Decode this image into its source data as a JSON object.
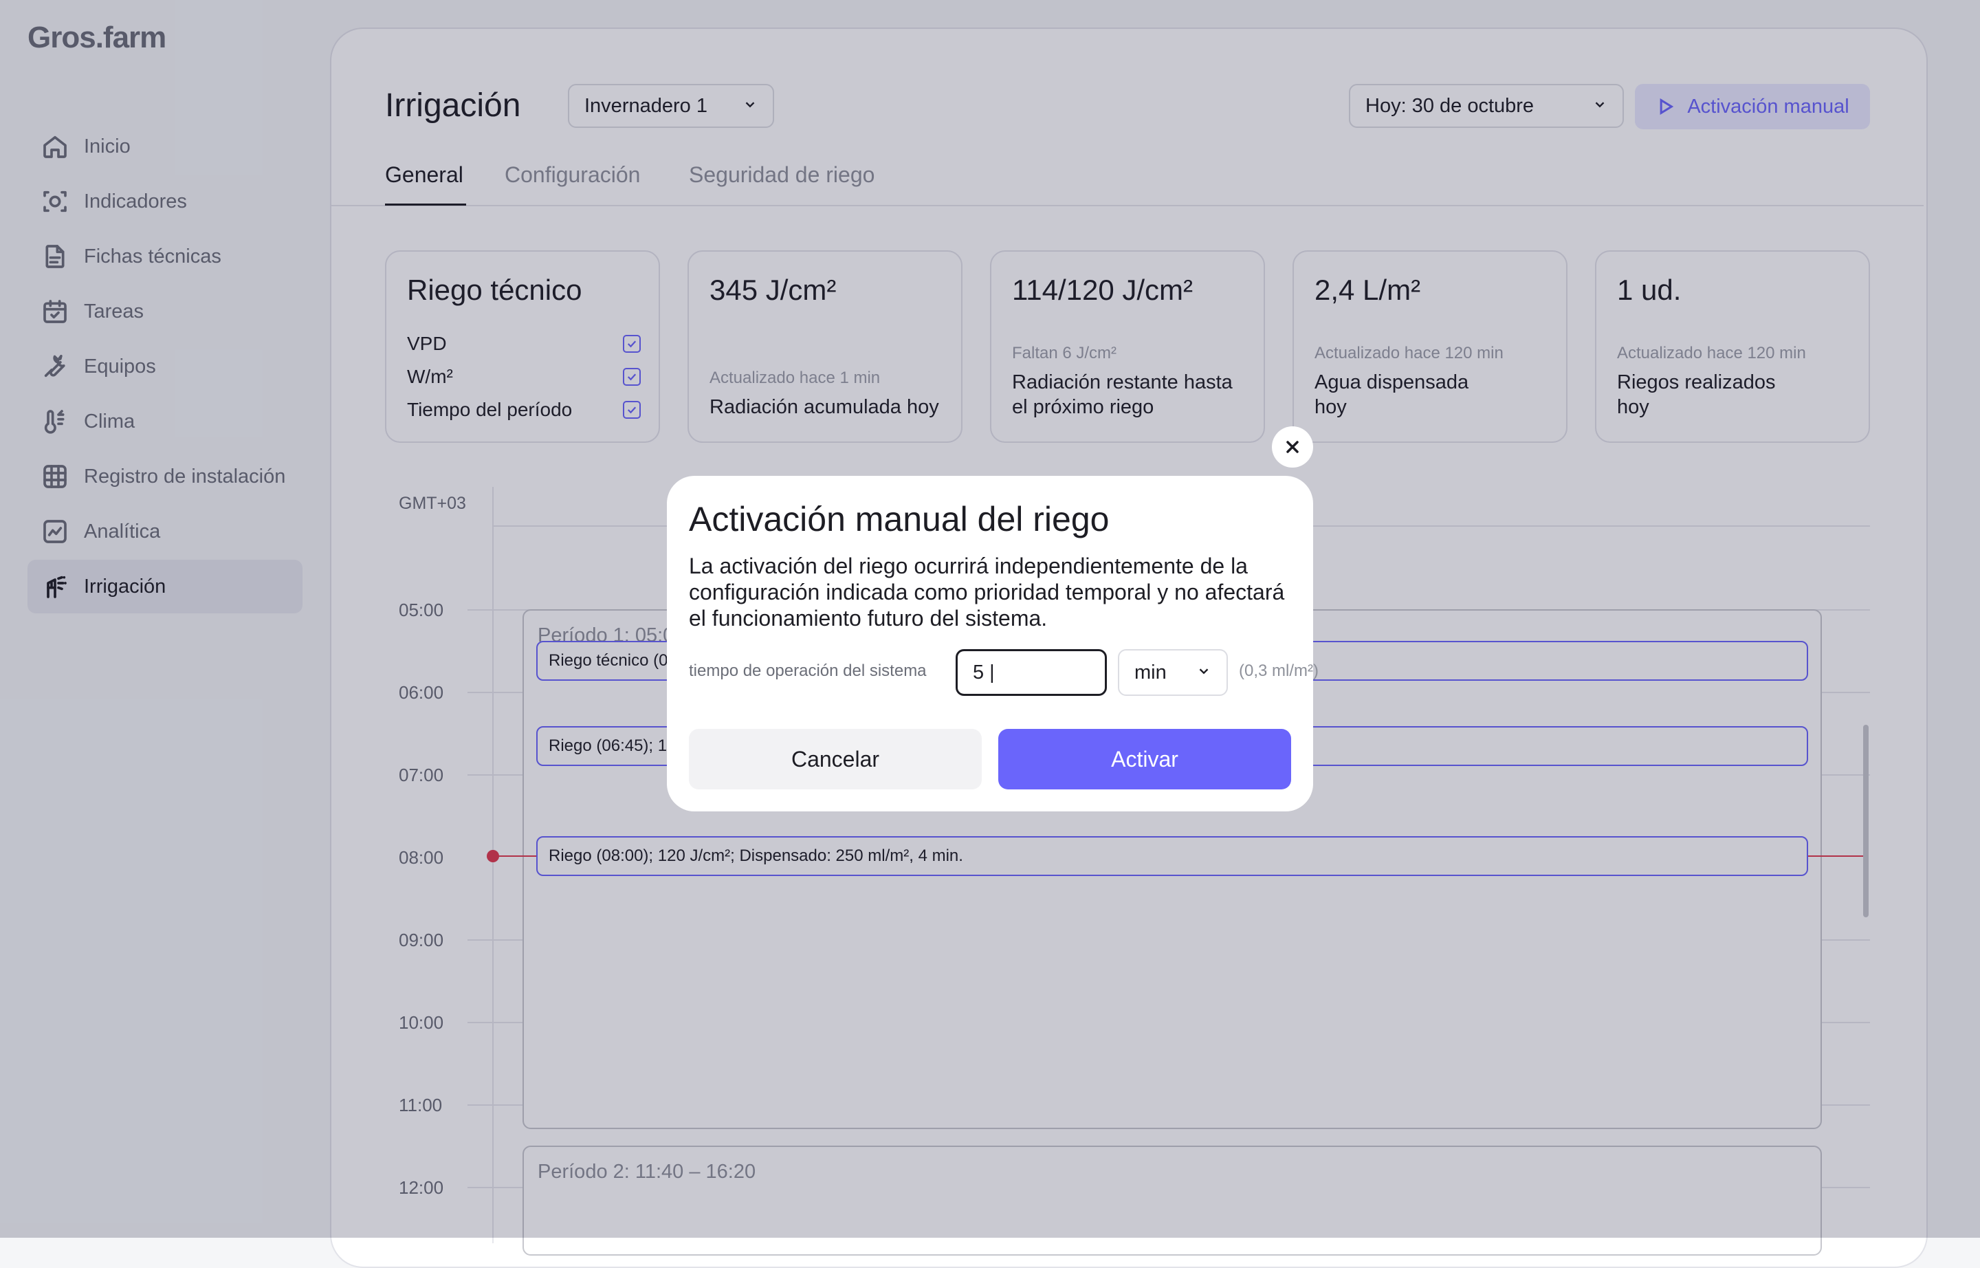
{
  "app": {
    "logo": "Gros.farm"
  },
  "sidebar": {
    "items": [
      {
        "label": "Inicio",
        "icon": "home-icon"
      },
      {
        "label": "Indicadores",
        "icon": "indicators-icon"
      },
      {
        "label": "Fichas técnicas",
        "icon": "document-icon"
      },
      {
        "label": "Tareas",
        "icon": "calendar-icon"
      },
      {
        "label": "Equipos",
        "icon": "wrench-icon"
      },
      {
        "label": "Clima",
        "icon": "thermometer-icon"
      },
      {
        "label": "Registro de instalación",
        "icon": "grid-icon"
      },
      {
        "label": "Analítica",
        "icon": "chart-icon"
      },
      {
        "label": "Irrigación",
        "icon": "sprinkler-icon",
        "active": true
      }
    ]
  },
  "header": {
    "title": "Irrigación",
    "greenhouse_select": "Invernadero 1",
    "date_select": "Hoy: 30 de octubre",
    "manual_button": "Activación manual"
  },
  "tabs": [
    {
      "label": "General",
      "active": true
    },
    {
      "label": "Configuración"
    },
    {
      "label": "Seguridad de riego"
    }
  ],
  "cards": {
    "technical": {
      "title": "Riego técnico",
      "checks": [
        {
          "label": "VPD",
          "checked": true
        },
        {
          "label": "W/m²",
          "checked": true
        },
        {
          "label": "Tiempo del período",
          "checked": true
        }
      ]
    },
    "radiation": {
      "value": "345 J/cm²",
      "meta": "Actualizado hace 1 min",
      "label": "Radiación acumulada hoy"
    },
    "remaining": {
      "value": "114/120 J/cm²",
      "meta": "Faltan 6 J/cm²",
      "label_1": "Radiación restante hasta",
      "label_2": "el próximo riego"
    },
    "water": {
      "value": "2,4 L/m²",
      "meta": "Actualizado hace 120 min",
      "label_1": "Agua dispensada",
      "label_2": "hoy"
    },
    "count": {
      "value": "1 ud.",
      "meta": "Actualizado hace 120 min",
      "label_1": "Riegos realizados",
      "label_2": "hoy"
    }
  },
  "timeline": {
    "timezone": "GMT+03",
    "hours": [
      "05:00",
      "06:00",
      "07:00",
      "08:00",
      "09:00",
      "10:00",
      "11:00",
      "12:00"
    ],
    "period1_label": "Período 1: 05:0",
    "period2_label": "Período 2: 11:40 – 16:20",
    "events": [
      "Riego técnico (0",
      "Riego (06:45); 1",
      "Riego (08:00); 120 J/cm²; Dispensado: 250 ml/m², 4 min."
    ]
  },
  "modal": {
    "title": "Activación manual del riego",
    "description": "La activación del riego ocurrirá independientemente de la configuración indicada como prioridad temporal y no afectará el funcionamiento futuro del sistema.",
    "field_label": "tiempo de operación del sistema",
    "field_value": "5 |",
    "unit": "min",
    "hint": "(0,3 ml/m²)",
    "cancel": "Cancelar",
    "activate": "Activar"
  },
  "colors": {
    "accent": "#6a65fb",
    "now_line": "#e0394e",
    "overlay": "rgba(28,31,62,0.24)"
  }
}
